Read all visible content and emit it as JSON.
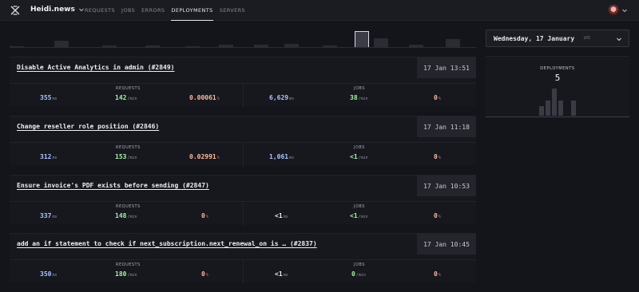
{
  "app": {
    "project_name": "Heidi.news",
    "logo_icon": "stacked-x-logo-icon",
    "avatar_icon": "user-avatar-icon"
  },
  "nav": {
    "items": [
      {
        "label": "REQUESTS",
        "active": false
      },
      {
        "label": "JOBS",
        "active": false
      },
      {
        "label": "ERRORS",
        "active": false
      },
      {
        "label": "DEPLOYMENTS",
        "active": true
      },
      {
        "label": "SERVERS",
        "active": false
      }
    ]
  },
  "date_picker": {
    "value": "Wednesday, 17 January",
    "timezone": "UTC"
  },
  "deployments_panel": {
    "label": "DEPLOYMENTS",
    "count": "5",
    "bar_levels": [
      0.35,
      0.55,
      1.0,
      0.55,
      0.0,
      0.55
    ]
  },
  "histogram": {
    "selected_index": 9,
    "levels": [
      0.05,
      0.35,
      0.1,
      0.08,
      0.06,
      0.12,
      0.15,
      0.2,
      0.1,
      0.9,
      0.5,
      0.12,
      0.45
    ]
  },
  "deployments": [
    {
      "title": "Disable Active Analytics in admin (#2849)",
      "time": "17 Jan 13:51",
      "requests_label": "REQUESTS",
      "jobs_label": "JOBS",
      "req_duration": "355",
      "req_duration_unit": "ms",
      "req_rate": "142",
      "req_rate_unit": "/min",
      "req_error": "0.00061",
      "req_error_unit": "%",
      "job_duration": "6,629",
      "job_duration_unit": "ms",
      "job_rate": "38",
      "job_rate_unit": "/min",
      "job_error": "0",
      "job_error_unit": "%"
    },
    {
      "title": "Change reseller role position (#2846)",
      "time": "17 Jan 11:18",
      "requests_label": "REQUESTS",
      "jobs_label": "JOBS",
      "req_duration": "312",
      "req_duration_unit": "ms",
      "req_rate": "153",
      "req_rate_unit": "/min",
      "req_error": "0.02991",
      "req_error_unit": "%",
      "job_duration": "1,061",
      "job_duration_unit": "ms",
      "job_rate": "<1",
      "job_rate_unit": "/min",
      "job_error": "0",
      "job_error_unit": "%"
    },
    {
      "title": "Ensure invoice's PDF exists before sending (#2847)",
      "time": "17 Jan 10:53",
      "requests_label": "REQUESTS",
      "jobs_label": "JOBS",
      "req_duration": "337",
      "req_duration_unit": "ms",
      "req_rate": "148",
      "req_rate_unit": "/min",
      "req_error": "0",
      "req_error_unit": "%",
      "job_duration": "<1",
      "job_duration_unit": "ms",
      "job_rate": "<1",
      "job_rate_unit": "/min",
      "job_error": "0",
      "job_error_unit": "%"
    },
    {
      "title": "add an if statement to check if next_subscription.next_renewal_on is … (#2837)",
      "time": "17 Jan 10:45",
      "requests_label": "REQUESTS",
      "jobs_label": "JOBS",
      "req_duration": "350",
      "req_duration_unit": "ms",
      "req_rate": "180",
      "req_rate_unit": "/min",
      "req_error": "0",
      "req_error_unit": "%",
      "job_duration": "<1",
      "job_duration_unit": "ms",
      "job_rate": "0",
      "job_rate_unit": "/min",
      "job_error": "0",
      "job_error_unit": "%"
    }
  ]
}
